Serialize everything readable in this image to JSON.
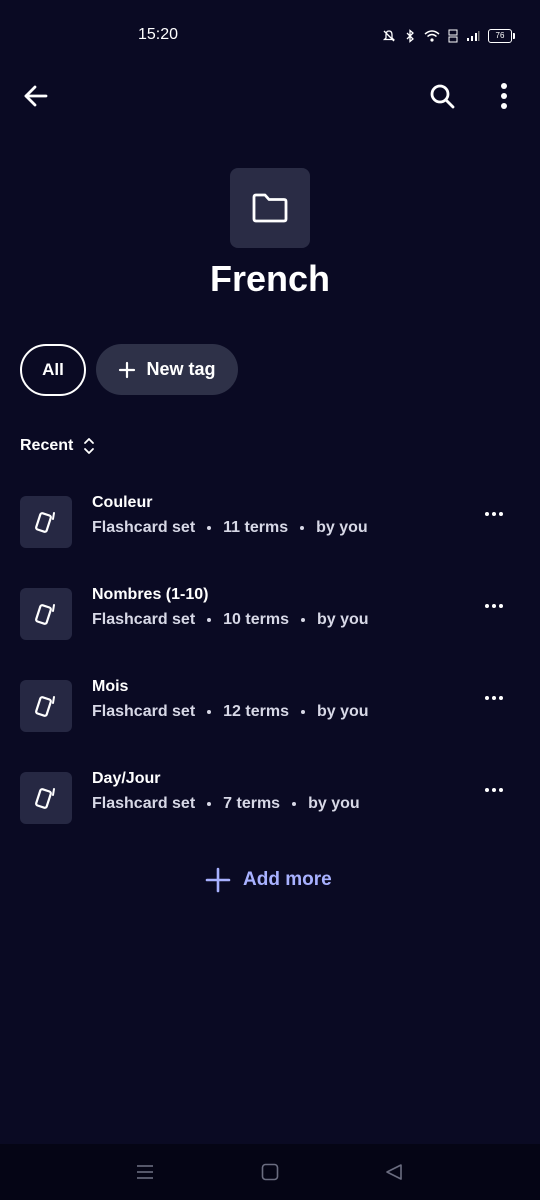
{
  "status_bar": {
    "time": "15:20",
    "battery": "76"
  },
  "header": {
    "back_icon": "arrow-left-icon",
    "search_icon": "search-icon",
    "more_icon": "more-vertical-icon"
  },
  "folder": {
    "icon": "folder-icon",
    "title": "French"
  },
  "filters": {
    "all_label": "All",
    "new_tag_label": "New tag"
  },
  "sort": {
    "label": "Recent",
    "icon": "sort-chevrons-icon"
  },
  "sets": [
    {
      "title": "Couleur",
      "type": "Flashcard set",
      "terms": "11 terms",
      "owner": "by you"
    },
    {
      "title": "Nombres (1-10)",
      "type": "Flashcard set",
      "terms": "10 terms",
      "owner": "by you"
    },
    {
      "title": "Mois",
      "type": "Flashcard set",
      "terms": "12 terms",
      "owner": "by you"
    },
    {
      "title": "Day/Jour",
      "type": "Flashcard set",
      "terms": "7 terms",
      "owner": "by you"
    }
  ],
  "add_more_label": "Add more",
  "colors": {
    "background": "#0a0a23",
    "tile": "#2a2c45",
    "accent": "#a8b1ff"
  }
}
